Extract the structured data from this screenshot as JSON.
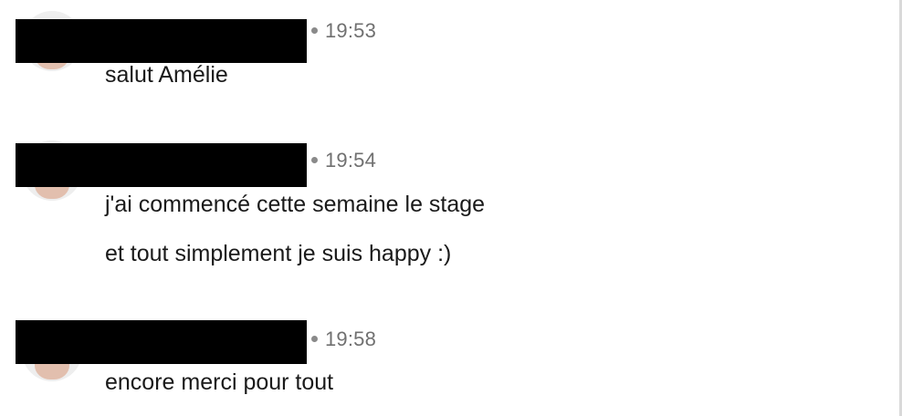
{
  "messages": [
    {
      "time": "19:53",
      "lines": [
        "salut Amélie"
      ]
    },
    {
      "time": "19:54",
      "lines": [
        "j'ai commencé cette semaine le stage",
        "et tout simplement je suis happy :)"
      ]
    },
    {
      "time": "19:58",
      "lines": [
        "encore merci pour tout"
      ]
    }
  ]
}
